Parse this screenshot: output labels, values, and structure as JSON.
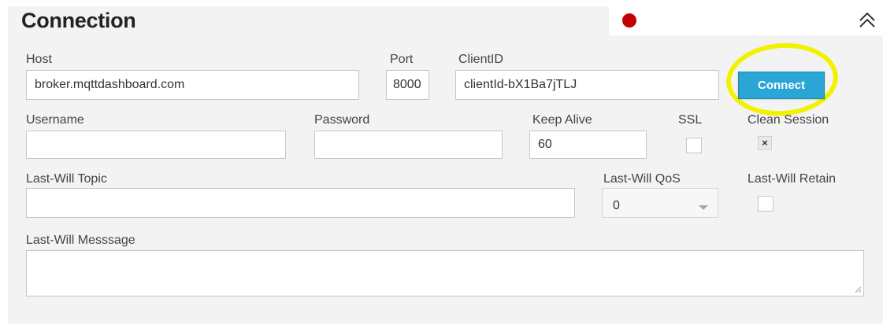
{
  "header": {
    "title": "Connection",
    "status_color": "#c40000",
    "collapse_icon": "double-chevron-up-icon"
  },
  "connection": {
    "host": {
      "label": "Host",
      "value": "broker.mqttdashboard.com"
    },
    "port": {
      "label": "Port",
      "value": "8000"
    },
    "client_id": {
      "label": "ClientID",
      "value": "clientId-bX1Ba7jTLJ"
    },
    "connect_label": "Connect",
    "connect_color": "#2aa6d6",
    "highlight_color": "#f2f200"
  },
  "credentials": {
    "username": {
      "label": "Username",
      "value": ""
    },
    "password": {
      "label": "Password",
      "value": ""
    },
    "keep_alive": {
      "label": "Keep Alive",
      "value": "60"
    },
    "ssl": {
      "label": "SSL",
      "checked": false
    },
    "clean_session": {
      "label": "Clean Session",
      "checked": true,
      "mark": "×"
    }
  },
  "last_will": {
    "topic": {
      "label": "Last-Will Topic",
      "value": ""
    },
    "qos": {
      "label": "Last-Will QoS",
      "value": "0"
    },
    "retain": {
      "label": "Last-Will Retain",
      "checked": false
    },
    "message": {
      "label": "Last-Will Messsage",
      "value": ""
    }
  }
}
